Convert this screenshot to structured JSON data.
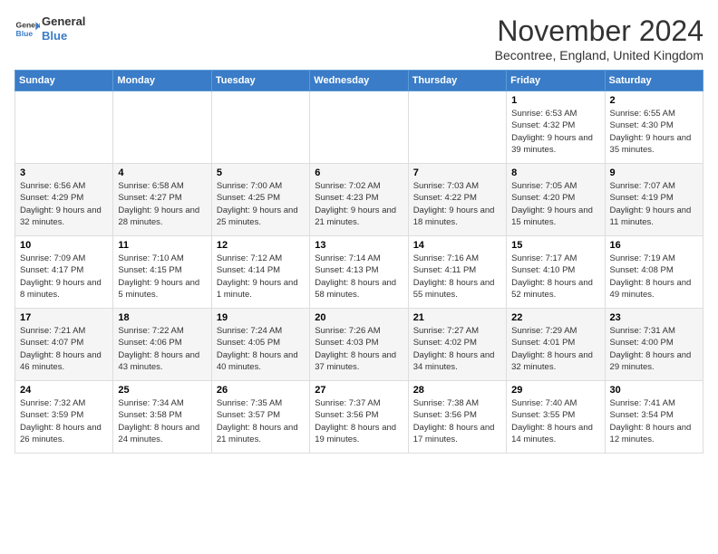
{
  "header": {
    "logo_line1": "General",
    "logo_line2": "Blue",
    "month_title": "November 2024",
    "subtitle": "Becontree, England, United Kingdom"
  },
  "days_of_week": [
    "Sunday",
    "Monday",
    "Tuesday",
    "Wednesday",
    "Thursday",
    "Friday",
    "Saturday"
  ],
  "weeks": [
    [
      {
        "day": "",
        "info": ""
      },
      {
        "day": "",
        "info": ""
      },
      {
        "day": "",
        "info": ""
      },
      {
        "day": "",
        "info": ""
      },
      {
        "day": "",
        "info": ""
      },
      {
        "day": "1",
        "info": "Sunrise: 6:53 AM\nSunset: 4:32 PM\nDaylight: 9 hours and 39 minutes."
      },
      {
        "day": "2",
        "info": "Sunrise: 6:55 AM\nSunset: 4:30 PM\nDaylight: 9 hours and 35 minutes."
      }
    ],
    [
      {
        "day": "3",
        "info": "Sunrise: 6:56 AM\nSunset: 4:29 PM\nDaylight: 9 hours and 32 minutes."
      },
      {
        "day": "4",
        "info": "Sunrise: 6:58 AM\nSunset: 4:27 PM\nDaylight: 9 hours and 28 minutes."
      },
      {
        "day": "5",
        "info": "Sunrise: 7:00 AM\nSunset: 4:25 PM\nDaylight: 9 hours and 25 minutes."
      },
      {
        "day": "6",
        "info": "Sunrise: 7:02 AM\nSunset: 4:23 PM\nDaylight: 9 hours and 21 minutes."
      },
      {
        "day": "7",
        "info": "Sunrise: 7:03 AM\nSunset: 4:22 PM\nDaylight: 9 hours and 18 minutes."
      },
      {
        "day": "8",
        "info": "Sunrise: 7:05 AM\nSunset: 4:20 PM\nDaylight: 9 hours and 15 minutes."
      },
      {
        "day": "9",
        "info": "Sunrise: 7:07 AM\nSunset: 4:19 PM\nDaylight: 9 hours and 11 minutes."
      }
    ],
    [
      {
        "day": "10",
        "info": "Sunrise: 7:09 AM\nSunset: 4:17 PM\nDaylight: 9 hours and 8 minutes."
      },
      {
        "day": "11",
        "info": "Sunrise: 7:10 AM\nSunset: 4:15 PM\nDaylight: 9 hours and 5 minutes."
      },
      {
        "day": "12",
        "info": "Sunrise: 7:12 AM\nSunset: 4:14 PM\nDaylight: 9 hours and 1 minute."
      },
      {
        "day": "13",
        "info": "Sunrise: 7:14 AM\nSunset: 4:13 PM\nDaylight: 8 hours and 58 minutes."
      },
      {
        "day": "14",
        "info": "Sunrise: 7:16 AM\nSunset: 4:11 PM\nDaylight: 8 hours and 55 minutes."
      },
      {
        "day": "15",
        "info": "Sunrise: 7:17 AM\nSunset: 4:10 PM\nDaylight: 8 hours and 52 minutes."
      },
      {
        "day": "16",
        "info": "Sunrise: 7:19 AM\nSunset: 4:08 PM\nDaylight: 8 hours and 49 minutes."
      }
    ],
    [
      {
        "day": "17",
        "info": "Sunrise: 7:21 AM\nSunset: 4:07 PM\nDaylight: 8 hours and 46 minutes."
      },
      {
        "day": "18",
        "info": "Sunrise: 7:22 AM\nSunset: 4:06 PM\nDaylight: 8 hours and 43 minutes."
      },
      {
        "day": "19",
        "info": "Sunrise: 7:24 AM\nSunset: 4:05 PM\nDaylight: 8 hours and 40 minutes."
      },
      {
        "day": "20",
        "info": "Sunrise: 7:26 AM\nSunset: 4:03 PM\nDaylight: 8 hours and 37 minutes."
      },
      {
        "day": "21",
        "info": "Sunrise: 7:27 AM\nSunset: 4:02 PM\nDaylight: 8 hours and 34 minutes."
      },
      {
        "day": "22",
        "info": "Sunrise: 7:29 AM\nSunset: 4:01 PM\nDaylight: 8 hours and 32 minutes."
      },
      {
        "day": "23",
        "info": "Sunrise: 7:31 AM\nSunset: 4:00 PM\nDaylight: 8 hours and 29 minutes."
      }
    ],
    [
      {
        "day": "24",
        "info": "Sunrise: 7:32 AM\nSunset: 3:59 PM\nDaylight: 8 hours and 26 minutes."
      },
      {
        "day": "25",
        "info": "Sunrise: 7:34 AM\nSunset: 3:58 PM\nDaylight: 8 hours and 24 minutes."
      },
      {
        "day": "26",
        "info": "Sunrise: 7:35 AM\nSunset: 3:57 PM\nDaylight: 8 hours and 21 minutes."
      },
      {
        "day": "27",
        "info": "Sunrise: 7:37 AM\nSunset: 3:56 PM\nDaylight: 8 hours and 19 minutes."
      },
      {
        "day": "28",
        "info": "Sunrise: 7:38 AM\nSunset: 3:56 PM\nDaylight: 8 hours and 17 minutes."
      },
      {
        "day": "29",
        "info": "Sunrise: 7:40 AM\nSunset: 3:55 PM\nDaylight: 8 hours and 14 minutes."
      },
      {
        "day": "30",
        "info": "Sunrise: 7:41 AM\nSunset: 3:54 PM\nDaylight: 8 hours and 12 minutes."
      }
    ]
  ]
}
